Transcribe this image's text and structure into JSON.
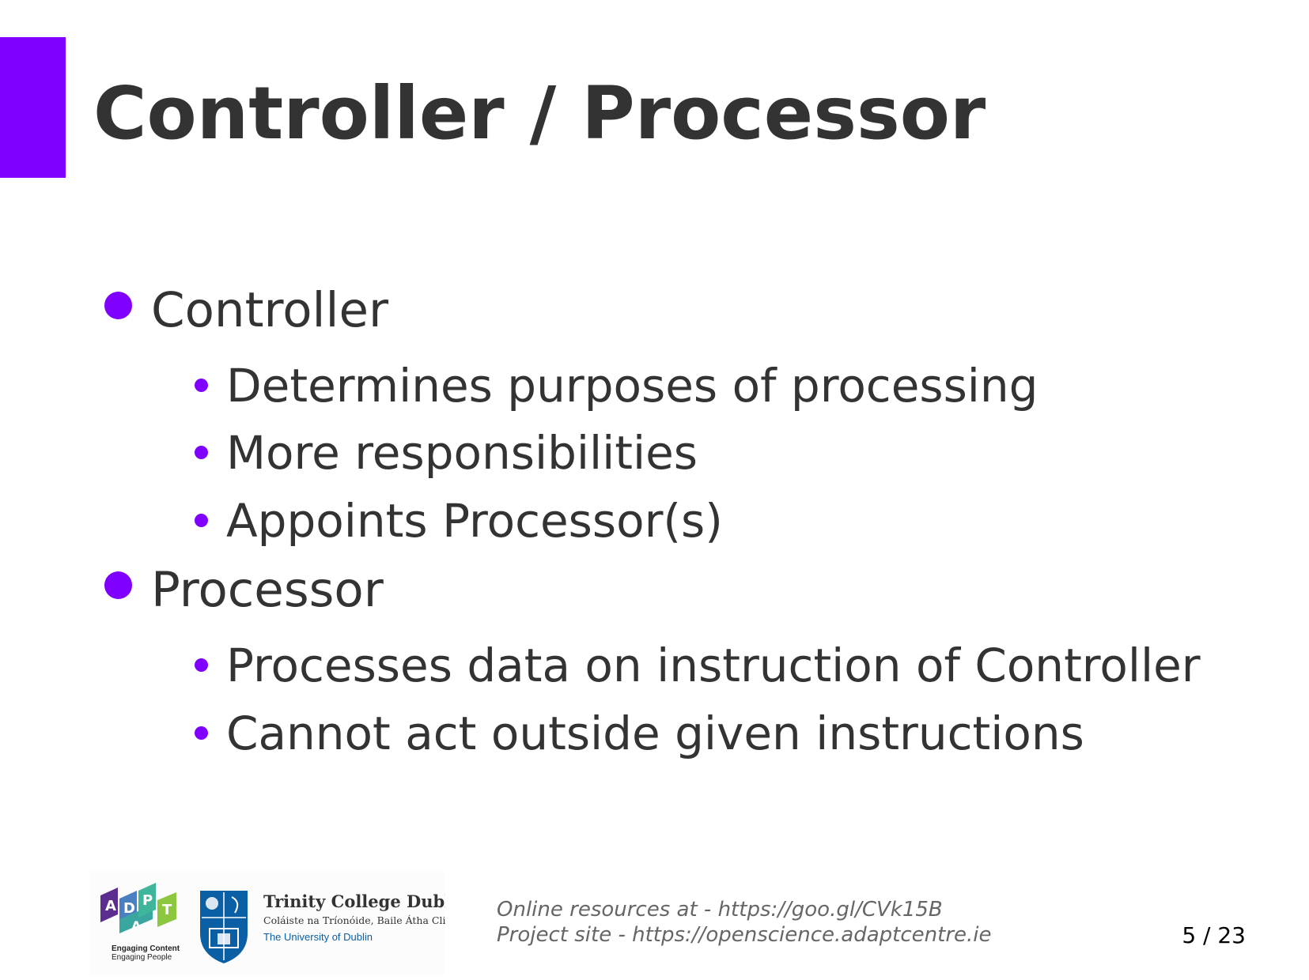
{
  "slide": {
    "title": "Controller / Processor",
    "accent_color": "#7f00ff",
    "bullets": [
      {
        "label": "Controller",
        "subitems": [
          "Determines purposes of processing",
          "More responsibilities",
          "Appoints Processor(s)"
        ]
      },
      {
        "label": "Processor",
        "subitems": [
          "Processes data on instruction of Controller",
          "Cannot act outside given instructions"
        ]
      }
    ]
  },
  "footer": {
    "adapt_logo": {
      "letters": [
        "A",
        "D",
        "A",
        "P",
        "T"
      ],
      "tagline_1": "Engaging Content",
      "tagline_2": "Engaging People"
    },
    "tcd_logo": {
      "name": "Trinity College Dublin",
      "irish_name": "Coláiste na Tríonóide, Baile Átha Cliath",
      "subtitle": "The University of Dublin"
    },
    "resources_text": "Online resources at - https://goo.gl/CVk15B",
    "project_text": "Project site - https://openscience.adaptcentre.ie",
    "page_number": "5 / 23"
  }
}
